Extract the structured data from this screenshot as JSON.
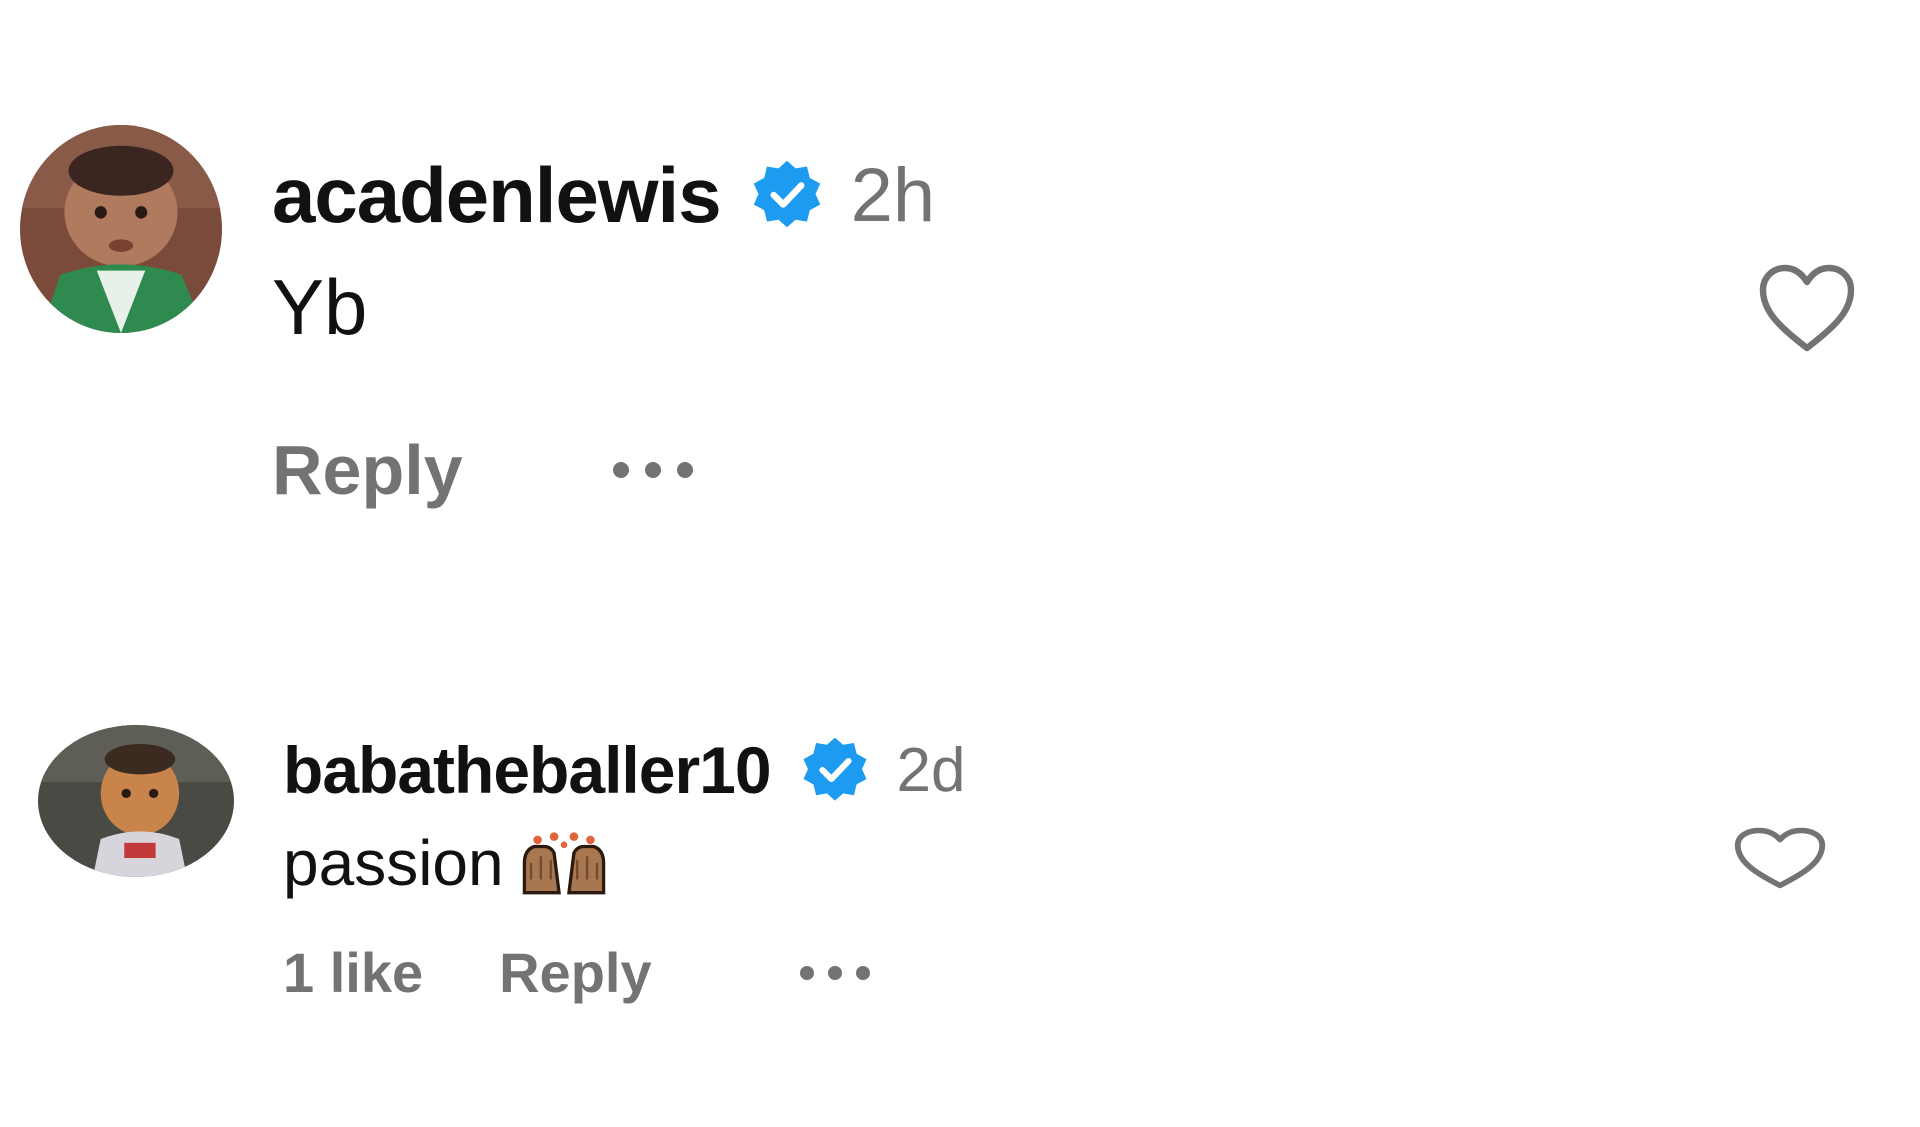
{
  "colors": {
    "verified_badge": "#1d9bf0",
    "text_primary": "#111111",
    "text_secondary": "#737373",
    "background": "#ffffff"
  },
  "comments": [
    {
      "username": "acadenlewis",
      "verified": true,
      "timestamp": "2h",
      "text": "Yb",
      "likes_label": "",
      "reply_label": "Reply",
      "more_icon": "more-options-icon",
      "like_icon": "heart-outline-icon"
    },
    {
      "username": "babatheballer10",
      "verified": true,
      "timestamp": "2d",
      "text": "passion",
      "emoji": "raising-hands-emoji",
      "likes_label": "1 like",
      "reply_label": "Reply",
      "more_icon": "more-options-icon",
      "like_icon": "heart-outline-icon"
    }
  ]
}
